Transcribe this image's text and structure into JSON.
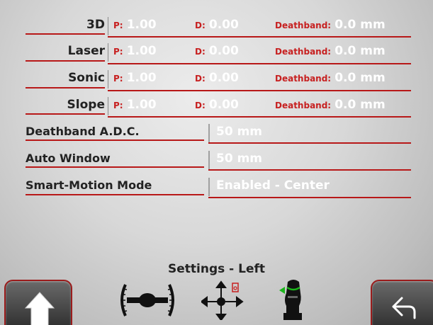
{
  "gains": [
    {
      "name": "3D",
      "p_label": "P:",
      "p_value": "1.00",
      "d_label": "D:",
      "d_value": "0.00",
      "db_label": "Deathband:",
      "db_value": "0.0 mm"
    },
    {
      "name": "Laser",
      "p_label": "P:",
      "p_value": "1.00",
      "d_label": "D:",
      "d_value": "0.00",
      "db_label": "Deathband:",
      "db_value": "0.0 mm"
    },
    {
      "name": "Sonic",
      "p_label": "P:",
      "p_value": "1.00",
      "d_label": "D:",
      "d_value": "0.00",
      "db_label": "Deathband:",
      "db_value": "0.0 mm"
    },
    {
      "name": "Slope",
      "p_label": "P:",
      "p_value": "1.00",
      "d_label": "D:",
      "d_value": "0.00",
      "db_label": "Deathband:",
      "db_value": "0.0 mm"
    }
  ],
  "params": [
    {
      "label": "Deathband A.D.C.",
      "value": "50 mm"
    },
    {
      "label": "Auto Window",
      "value": "50 mm"
    },
    {
      "label": "Smart-Motion Mode",
      "value": "Enabled - Center"
    }
  ],
  "footer": {
    "title": "Settings - Left",
    "home_icon": "home-icon",
    "back_icon": "back-arrow-icon",
    "tabs": [
      "slope-sensor-icon",
      "move-arrows-icon",
      "joystick-icon"
    ]
  },
  "colors": {
    "accent_red": "#b81818",
    "value_red": "#c72020",
    "value_white": "#ffffff"
  }
}
